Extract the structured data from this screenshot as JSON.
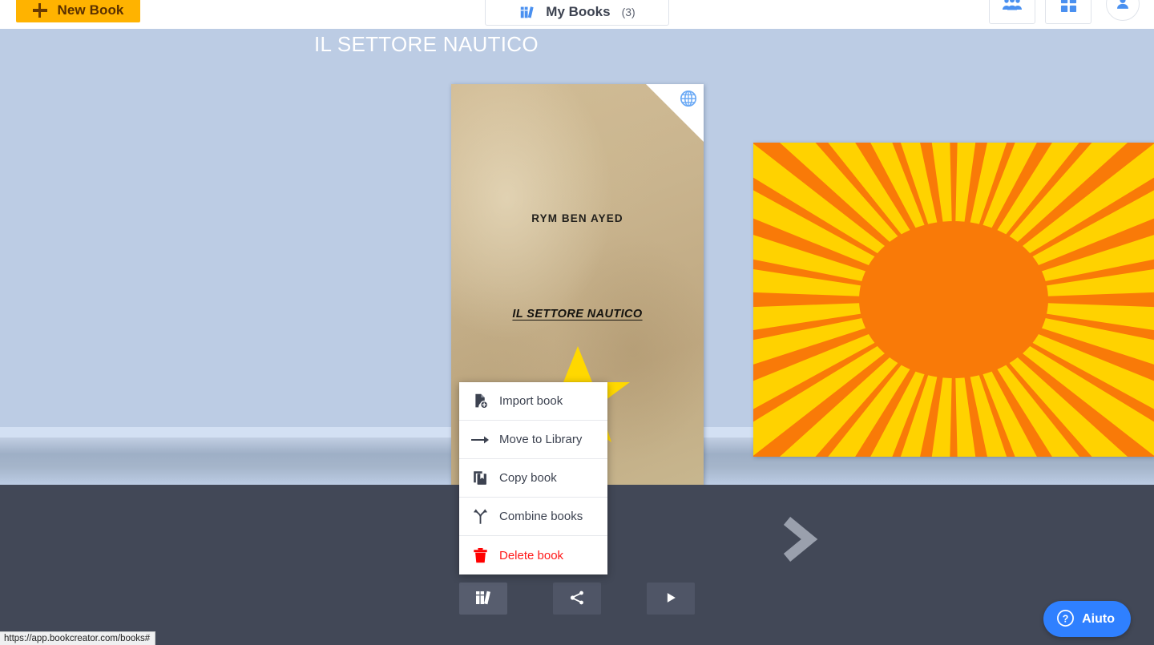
{
  "app": {
    "url_status": "https://app.bookcreator.com/books#"
  },
  "topbar": {
    "new_book_label": "New Book",
    "new_book_icon": "plus-icon",
    "tab_label": "My Books",
    "tab_count": "(3)",
    "tab_icon": "books-icon",
    "icons": {
      "people": "people-group-icon",
      "apps": "apps-grid-icon",
      "avatar": "user-avatar-icon"
    },
    "accent_color": "#ffb300",
    "brand_blue": "#4a90f0"
  },
  "shelf": {
    "background_color": "#bccce4",
    "books": [
      {
        "name": "book-cover-settore-nautico",
        "author": "RYM BEN AYED",
        "title": "IL SETTORE NAUTICO",
        "badge_icon": "globe-icon",
        "cover_color": "#c9b48e"
      },
      {
        "name": "book-cover-sunburst",
        "title": "",
        "cover_color": "#ffd200",
        "ray_color": "#f97a08"
      }
    ]
  },
  "detail": {
    "title": "IL SETTORE NAUTICO",
    "next_icon": "chevron-right-icon",
    "actions": [
      {
        "name": "library-button",
        "icon": "books-icon"
      },
      {
        "name": "share-button",
        "icon": "share-icon"
      },
      {
        "name": "play-button",
        "icon": "play-icon"
      }
    ],
    "panel_color": "#424857"
  },
  "context_menu": {
    "items": [
      {
        "label": "Import book",
        "icon": "file-import-icon",
        "danger": false
      },
      {
        "label": "Move to Library",
        "icon": "arrow-right-icon",
        "danger": false
      },
      {
        "label": "Copy book",
        "icon": "copy-book-icon",
        "danger": false
      },
      {
        "label": "Combine books",
        "icon": "merge-icon",
        "danger": false
      },
      {
        "label": "Delete book",
        "icon": "trash-icon",
        "danger": true
      }
    ],
    "danger_color": "#ff1a1a"
  },
  "help": {
    "label": "Aiuto",
    "icon": "question-circle-icon",
    "color": "#2f80ff"
  }
}
